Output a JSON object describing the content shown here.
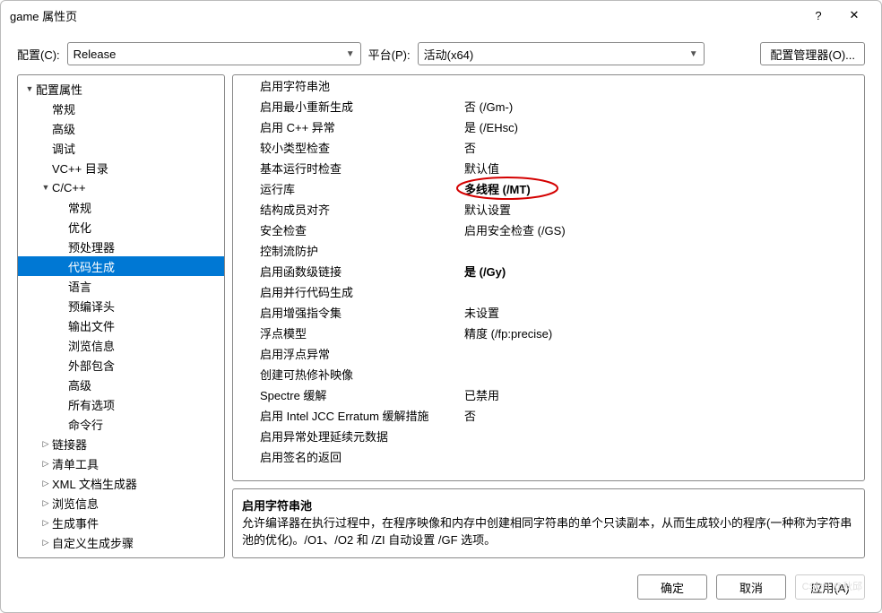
{
  "title": "game 属性页",
  "helpGlyph": "?",
  "closeGlyph": "✕",
  "configRow": {
    "configLabel": "配置(C):",
    "configValue": "Release",
    "platformLabel": "平台(P):",
    "platformValue": "活动(x64)",
    "managerLabel": "配置管理器(O)..."
  },
  "tree": [
    {
      "label": "配置属性",
      "indent": 0,
      "exp": "▼"
    },
    {
      "label": "常规",
      "indent": 1,
      "exp": ""
    },
    {
      "label": "高级",
      "indent": 1,
      "exp": ""
    },
    {
      "label": "调试",
      "indent": 1,
      "exp": ""
    },
    {
      "label": "VC++ 目录",
      "indent": 1,
      "exp": ""
    },
    {
      "label": "C/C++",
      "indent": 1,
      "exp": "▼"
    },
    {
      "label": "常规",
      "indent": 2,
      "exp": ""
    },
    {
      "label": "优化",
      "indent": 2,
      "exp": ""
    },
    {
      "label": "预处理器",
      "indent": 2,
      "exp": ""
    },
    {
      "label": "代码生成",
      "indent": 2,
      "exp": "",
      "selected": true
    },
    {
      "label": "语言",
      "indent": 2,
      "exp": ""
    },
    {
      "label": "预编译头",
      "indent": 2,
      "exp": ""
    },
    {
      "label": "输出文件",
      "indent": 2,
      "exp": ""
    },
    {
      "label": "浏览信息",
      "indent": 2,
      "exp": ""
    },
    {
      "label": "外部包含",
      "indent": 2,
      "exp": ""
    },
    {
      "label": "高级",
      "indent": 2,
      "exp": ""
    },
    {
      "label": "所有选项",
      "indent": 2,
      "exp": ""
    },
    {
      "label": "命令行",
      "indent": 2,
      "exp": ""
    },
    {
      "label": "链接器",
      "indent": 1,
      "exp": "▷"
    },
    {
      "label": "清单工具",
      "indent": 1,
      "exp": "▷"
    },
    {
      "label": "XML 文档生成器",
      "indent": 1,
      "exp": "▷"
    },
    {
      "label": "浏览信息",
      "indent": 1,
      "exp": "▷"
    },
    {
      "label": "生成事件",
      "indent": 1,
      "exp": "▷"
    },
    {
      "label": "自定义生成步骤",
      "indent": 1,
      "exp": "▷"
    }
  ],
  "properties": [
    {
      "name": "启用字符串池",
      "value": ""
    },
    {
      "name": "启用最小重新生成",
      "value": "否 (/Gm-)"
    },
    {
      "name": "启用 C++ 异常",
      "value": "是 (/EHsc)"
    },
    {
      "name": "较小类型检查",
      "value": "否"
    },
    {
      "name": "基本运行时检查",
      "value": "默认值"
    },
    {
      "name": "运行库",
      "value": "多线程 (/MT)",
      "bold": true,
      "circled": true
    },
    {
      "name": "结构成员对齐",
      "value": "默认设置"
    },
    {
      "name": "安全检查",
      "value": "启用安全检查 (/GS)"
    },
    {
      "name": "控制流防护",
      "value": ""
    },
    {
      "name": "启用函数级链接",
      "value": "是 (/Gy)",
      "bold": true
    },
    {
      "name": "启用并行代码生成",
      "value": ""
    },
    {
      "name": "启用增强指令集",
      "value": "未设置"
    },
    {
      "name": "浮点模型",
      "value": "精度 (/fp:precise)"
    },
    {
      "name": "启用浮点异常",
      "value": ""
    },
    {
      "name": "创建可热修补映像",
      "value": ""
    },
    {
      "name": "Spectre 缓解",
      "value": "已禁用"
    },
    {
      "name": "启用 Intel JCC Erratum 缓解措施",
      "value": "否"
    },
    {
      "name": "启用异常处理延续元数据",
      "value": ""
    },
    {
      "name": "启用签名的返回",
      "value": ""
    }
  ],
  "description": {
    "title": "启用字符串池",
    "body": "允许编译器在执行过程中，在程序映像和内存中创建相同字符串的单个只读副本，从而生成较小的程序(一种称为字符串池的优化)。/O1、/O2 和 /ZI 自动设置 /GF 选项。"
  },
  "footer": {
    "ok": "确定",
    "cancel": "取消",
    "apply": "应用(A)"
  },
  "watermark": "CSDN @秋邱"
}
